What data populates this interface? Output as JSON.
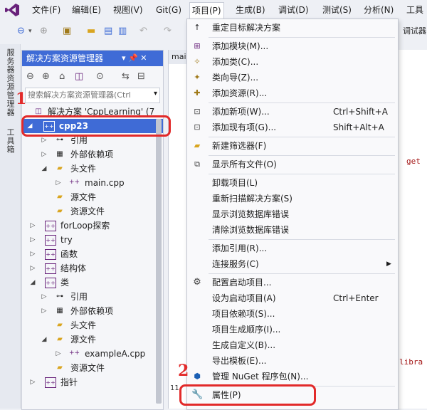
{
  "menubar": {
    "items": [
      "文件(F)",
      "编辑(E)",
      "视图(V)",
      "Git(G)",
      "项目(P)",
      "生成(B)",
      "调试(D)",
      "测试(S)",
      "分析(N)",
      "工具"
    ]
  },
  "toolbar": {
    "right_text": "调试器"
  },
  "vertical_tabs": [
    "服务器资源管理器",
    "工具箱"
  ],
  "solution_explorer": {
    "title": "解决方案资源管理器",
    "pin": "▾ 📌 ✕",
    "search_placeholder": "搜索解决方案资源管理器(Ctrl",
    "tree": [
      {
        "label": "解决方案 'CppLearning' (7",
        "arrow": "",
        "icon": "solution-icon"
      },
      {
        "label": "cpp23",
        "arrow": "◢",
        "icon": "project-icon"
      },
      {
        "label": "引用",
        "arrow": "▷",
        "icon": "references-icon"
      },
      {
        "label": "外部依赖项",
        "arrow": "▷",
        "icon": "external-deps-icon"
      },
      {
        "label": "头文件",
        "arrow": "◢",
        "icon": "folder-icon"
      },
      {
        "label": "main.cpp",
        "arrow": "▷",
        "icon": "cpp-file-icon"
      },
      {
        "label": "源文件",
        "arrow": "",
        "icon": "folder-icon"
      },
      {
        "label": "资源文件",
        "arrow": "",
        "icon": "folder-icon"
      },
      {
        "label": "forLoop探索",
        "arrow": "▷",
        "icon": "project-icon"
      },
      {
        "label": "try",
        "arrow": "▷",
        "icon": "project-icon"
      },
      {
        "label": "函数",
        "arrow": "▷",
        "icon": "project-icon"
      },
      {
        "label": "结构体",
        "arrow": "▷",
        "icon": "project-icon"
      },
      {
        "label": "类",
        "arrow": "◢",
        "icon": "project-icon"
      },
      {
        "label": "引用",
        "arrow": "▷",
        "icon": "references-icon"
      },
      {
        "label": "外部依赖项",
        "arrow": "▷",
        "icon": "external-deps-icon"
      },
      {
        "label": "头文件",
        "arrow": "",
        "icon": "folder-icon"
      },
      {
        "label": "源文件",
        "arrow": "◢",
        "icon": "folder-icon"
      },
      {
        "label": "exampleA.cpp",
        "arrow": "▷",
        "icon": "cpp-file-icon"
      },
      {
        "label": "资源文件",
        "arrow": "",
        "icon": "folder-icon"
      },
      {
        "label": "指针",
        "arrow": "▷",
        "icon": "project-icon"
      }
    ]
  },
  "editor": {
    "tab_text": "mai",
    "code_fragments": [
      "get",
      "libra"
    ],
    "status_text": "11"
  },
  "annotations": {
    "marker_1": "1",
    "marker_2": "2"
  },
  "project_menu": {
    "items": [
      {
        "label": "重定目标解决方案",
        "shortcut": "",
        "icon": "up-arrow-icon"
      },
      {
        "label": "添加模块(M)...",
        "shortcut": "",
        "icon": "add-module-icon"
      },
      {
        "label": "添加类(C)...",
        "shortcut": "",
        "icon": "add-class-icon"
      },
      {
        "label": "类向导(Z)...",
        "shortcut": "",
        "icon": "class-wizard-icon"
      },
      {
        "label": "添加资源(R)...",
        "shortcut": "",
        "icon": "add-resource-icon"
      },
      {
        "label": "添加新项(W)...",
        "shortcut": "Ctrl+Shift+A",
        "icon": "add-new-item-icon"
      },
      {
        "label": "添加现有项(G)...",
        "shortcut": "Shift+Alt+A",
        "icon": "add-existing-item-icon"
      },
      {
        "label": "新建筛选器(F)",
        "shortcut": "",
        "icon": "new-filter-icon"
      },
      {
        "label": "显示所有文件(O)",
        "shortcut": "",
        "icon": "show-all-files-icon"
      },
      {
        "label": "卸载项目(L)",
        "shortcut": "",
        "icon": ""
      },
      {
        "label": "重新扫描解决方案(S)",
        "shortcut": "",
        "icon": ""
      },
      {
        "label": "显示浏览数据库错误",
        "shortcut": "",
        "icon": ""
      },
      {
        "label": "清除浏览数据库错误",
        "shortcut": "",
        "icon": ""
      },
      {
        "label": "添加引用(R)...",
        "shortcut": "",
        "icon": ""
      },
      {
        "label": "连接服务(C)",
        "shortcut": "",
        "icon": "",
        "submenu": "▶"
      },
      {
        "label": "配置启动项目...",
        "shortcut": "",
        "icon": "gear-icon"
      },
      {
        "label": "设为启动项目(A)",
        "shortcut": "Ctrl+Enter",
        "icon": ""
      },
      {
        "label": "项目依赖项(S)...",
        "shortcut": "",
        "icon": ""
      },
      {
        "label": "项目生成顺序(I)...",
        "shortcut": "",
        "icon": ""
      },
      {
        "label": "生成自定义(B)...",
        "shortcut": "",
        "icon": ""
      },
      {
        "label": "导出模板(E)...",
        "shortcut": "",
        "icon": ""
      },
      {
        "label": "管理 NuGet 程序包(N)...",
        "shortcut": "",
        "icon": "nuget-icon"
      },
      {
        "label": "属性(P)",
        "shortcut": "",
        "icon": "wrench-icon"
      }
    ]
  },
  "colors": {
    "accent": "#3f6bd6",
    "annotation": "#e22a2a",
    "logo": "#68217a"
  }
}
